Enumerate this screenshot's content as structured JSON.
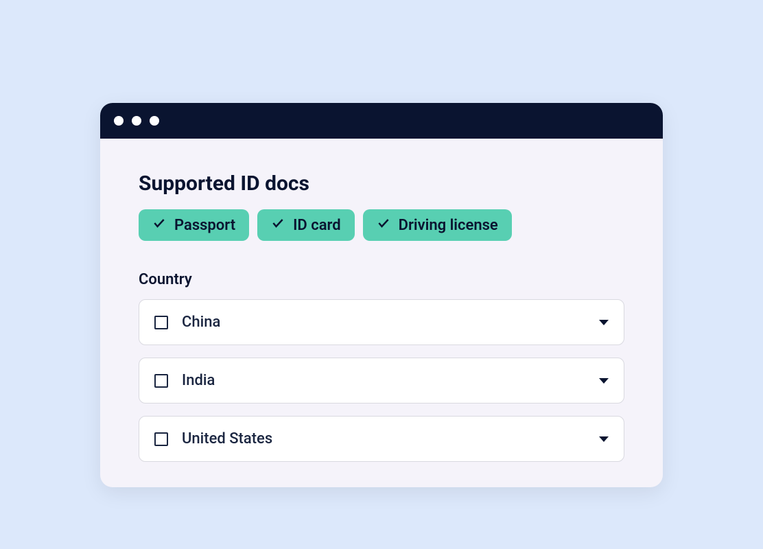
{
  "title": "Supported ID docs",
  "doc_types": [
    {
      "label": "Passport"
    },
    {
      "label": "ID card"
    },
    {
      "label": "Driving license"
    }
  ],
  "country_section_label": "Country",
  "countries": [
    {
      "label": "China"
    },
    {
      "label": "India"
    },
    {
      "label": "United States"
    }
  ]
}
